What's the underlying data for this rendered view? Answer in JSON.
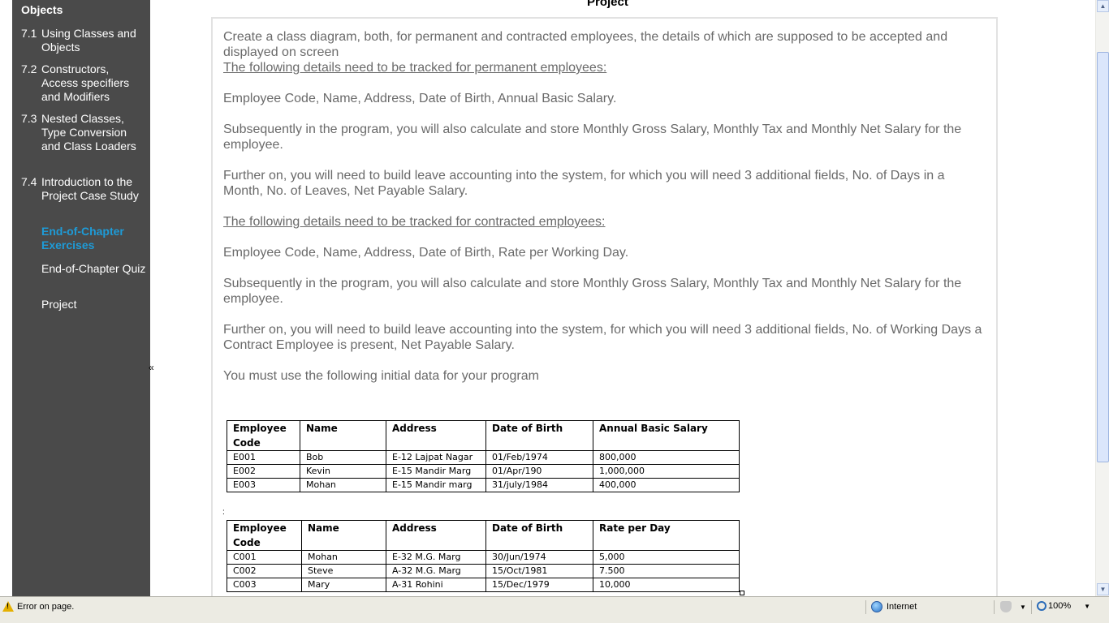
{
  "sidebar": {
    "heading": "Objects",
    "items": [
      {
        "num": "7.1",
        "label": "Using Classes and Objects"
      },
      {
        "num": "7.2",
        "label": "Constructors, Access specifiers and Modifiers"
      },
      {
        "num": "7.3",
        "label": "Nested Classes, Type Conversion and Class Loaders"
      },
      {
        "num": "7.4",
        "label": "Introduction to the Project Case Study"
      }
    ],
    "subitems": [
      {
        "label": "End-of-Chapter Exercises",
        "active": true
      },
      {
        "label": "End-of-Chapter Quiz",
        "active": false
      },
      {
        "label": "Project",
        "active": false
      }
    ],
    "collapse_glyph": "«"
  },
  "content": {
    "title": "Project",
    "intro": "Create a class diagram, both, for permanent and contracted employees, the details of which are supposed to be accepted and displayed on screen",
    "perm_heading": "The following details need to be tracked for permanent employees:",
    "perm_fields": "Employee Code, Name, Address, Date of Birth, Annual Basic Salary.",
    "perm_calc": "Subsequently in the program, you will also calculate and store Monthly Gross Salary, Monthly Tax and Monthly Net Salary for the employee.",
    "perm_leave": "Further on, you will need to build leave accounting into the system, for which you will need 3 additional fields, No. of Days in a Month, No. of Leaves, Net Payable Salary.",
    "contract_heading": "The following details need to be tracked for contracted employees:",
    "contract_fields": "Employee Code, Name, Address, Date of Birth, Rate per Working Day.",
    "contract_calc": "Subsequently in the program, you will also calculate and store Monthly Gross Salary, Monthly Tax and Monthly Net Salary for the employee.",
    "contract_leave": "Further on, you will need to build leave accounting into the system, for which you will need 3 additional fields, No. of Working Days a Contract Employee is present, Net Payable Salary.",
    "initial_data": "You must use the following initial data for your program"
  },
  "table_permanent": {
    "headers": [
      "Employee Code",
      "Name",
      "Address",
      "Date of Birth",
      "Annual Basic Salary"
    ],
    "rows": [
      [
        "E001",
        "Bob",
        "E-12 Lajpat Nagar",
        "01/Feb/1974",
        "800,000"
      ],
      [
        "E002",
        "Kevin",
        "E-15 Mandir Marg",
        "01/Apr/190",
        "1,000,000"
      ],
      [
        "E003",
        "Mohan",
        "E-15 Mandir marg",
        "31/july/1984",
        "400,000"
      ]
    ]
  },
  "table_contract": {
    "headers": [
      "Employee Code",
      "Name",
      "Address",
      "Date of Birth",
      "Rate per Day"
    ],
    "rows": [
      [
        "C001",
        "Mohan",
        "E-32 M.G. Marg",
        "30/Jun/1974",
        "5,000"
      ],
      [
        "C002",
        "Steve",
        "A-32 M.G. Marg",
        "15/Oct/1981",
        "7.500"
      ],
      [
        "C003",
        "Mary",
        "A-31 Rohini",
        "15/Dec/1979",
        "10,000"
      ]
    ]
  },
  "statusbar": {
    "message": "Error on page.",
    "zone": "Internet",
    "zoom": "100%"
  }
}
